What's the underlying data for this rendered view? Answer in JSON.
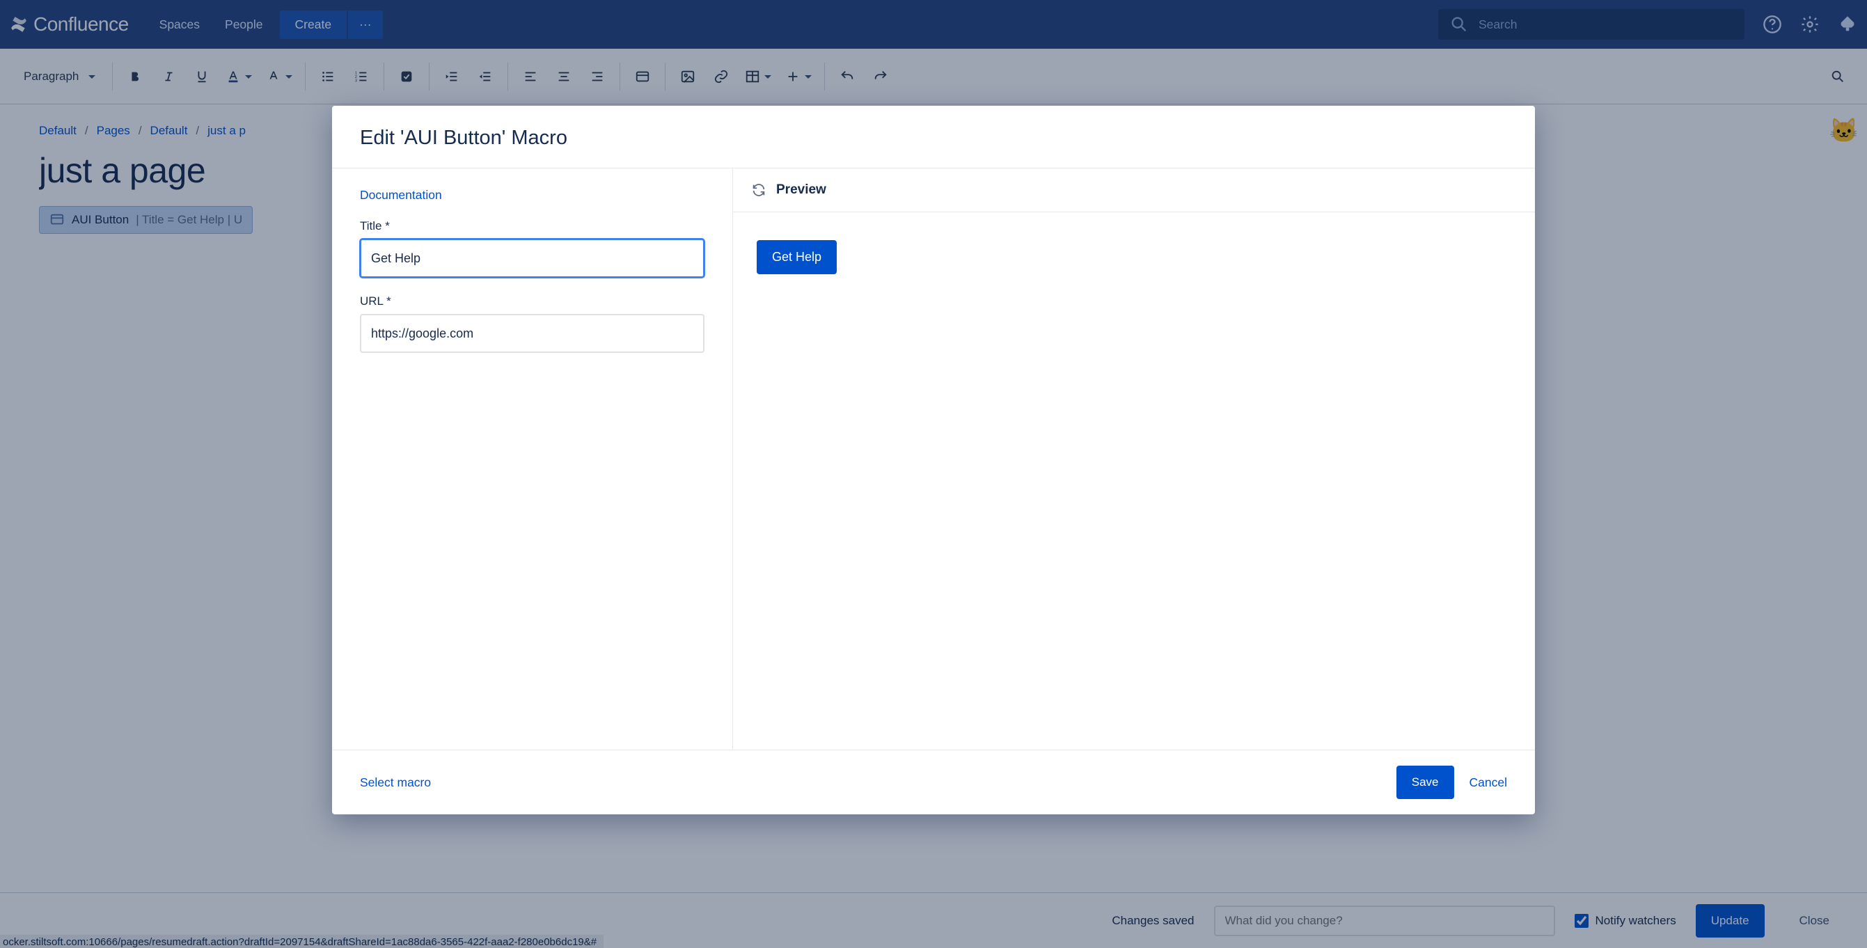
{
  "header": {
    "product": "Confluence",
    "nav": {
      "spaces": "Spaces",
      "people": "People",
      "create": "Create",
      "more": "···"
    },
    "search_placeholder": "Search"
  },
  "toolbar": {
    "style_label": "Paragraph"
  },
  "breadcrumb": [
    "Default",
    "Pages",
    "Default",
    "just a p"
  ],
  "page": {
    "title": "just a page",
    "macro_chip": {
      "name": "AUI Button",
      "rest": " | Title = Get Help | U"
    }
  },
  "bottom": {
    "status": "Changes saved",
    "comment_placeholder": "What did you change?",
    "notify_label": "Notify watchers",
    "notify_checked": true,
    "update": "Update",
    "close": "Close",
    "status_url": "ocker.stiltsoft.com:10666/pages/resumedraft.action?draftId=2097154&draftShareId=1ac88da6-3565-422f-aaa2-f280e0b6dc19&#"
  },
  "modal": {
    "title": "Edit 'AUI Button' Macro",
    "doc_link": "Documentation",
    "fields": {
      "title": {
        "label": "Title *",
        "value": "Get Help"
      },
      "url": {
        "label": "URL *",
        "value": "https://google.com"
      }
    },
    "preview_label": "Preview",
    "preview_button": "Get Help",
    "footer": {
      "select_macro": "Select macro",
      "save": "Save",
      "cancel": "Cancel"
    }
  },
  "user_badge": "🐱"
}
